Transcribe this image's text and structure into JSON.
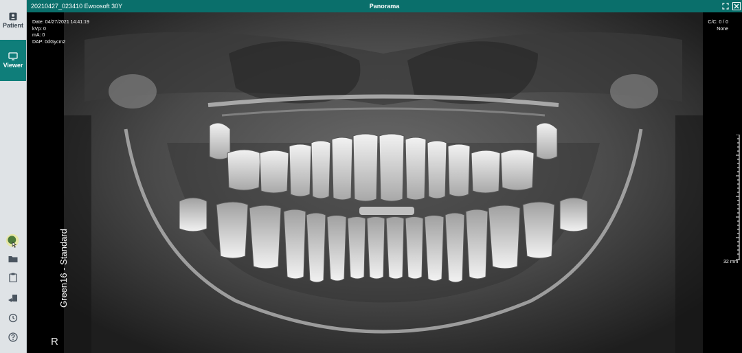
{
  "sidebar": {
    "nav": [
      {
        "label": "Patient",
        "icon": "patient-icon"
      },
      {
        "label": "Viewer",
        "icon": "monitor-icon"
      }
    ],
    "tools": [
      "image-tool-icon",
      "folder-icon",
      "clipboard-icon",
      "export-icon",
      "history-icon",
      "help-icon"
    ]
  },
  "titlebar": {
    "patient_info": "20210427_023410 Ewoosoft 30Y",
    "view_title": "Panorama"
  },
  "viewer": {
    "info": {
      "date": "Date: 04/27/2021 14:41:19",
      "kvp": "kVp: 0",
      "ma": "mA: 0",
      "dap": "DAP: 0dGycm2"
    },
    "info_right": {
      "cc": "C/C: 0 / 0",
      "filter": "None"
    },
    "filter_label": "Green16 - Standard",
    "side_marker": "R",
    "scale_label": "32 mm",
    "colors": {
      "accent": "#0f7e7a",
      "titlebar": "#0a6f6b"
    }
  }
}
